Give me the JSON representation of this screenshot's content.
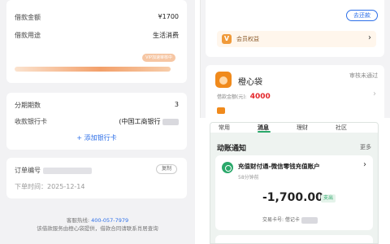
{
  "left": {
    "loan_amount_label": "借款金额",
    "loan_amount_value": "¥1700",
    "purpose_label": "借款用途",
    "purpose_value": "生活消费",
    "vip_badge": "VIP加速审核中",
    "period_label": "分期期数",
    "period_value": "3",
    "bank_label": "收款银行卡",
    "bank_value": "(中国工商银行",
    "add_bank": "+ 添加银行卡",
    "order_label": "订单编号",
    "copy_button": "复制",
    "order_time": "下单时间：2025-12-14",
    "hotline_label": "客服热线:",
    "hotline_number": "400-057-7979",
    "footer_note": "该借款服务由橙心袋提供，借款合同请联系肖居查询"
  },
  "right_top": {
    "repay_button": "去还款",
    "member_rights": "会员权益",
    "member_icon": "V",
    "product_name": "橙心袋",
    "review_status": "审核未通过",
    "loan_amount_label": "借款金额(元):",
    "loan_amount_value": "4000"
  },
  "right_bottom": {
    "tabs": [
      "常用",
      "消息",
      "理财",
      "社区"
    ],
    "section_title": "动账通知",
    "more": "更多",
    "notice_title": "充值财付通-微信零钱充值账户",
    "notice_time": "58分钟前",
    "amount": "-1,700.00",
    "tag": "支出",
    "card_label": "交易卡号: 借记卡"
  },
  "colors": {
    "accent_blue": "#2d6fe8",
    "accent_orange": "#f08a1c",
    "accent_red": "#e4262a",
    "accent_green": "#2aa86a"
  }
}
